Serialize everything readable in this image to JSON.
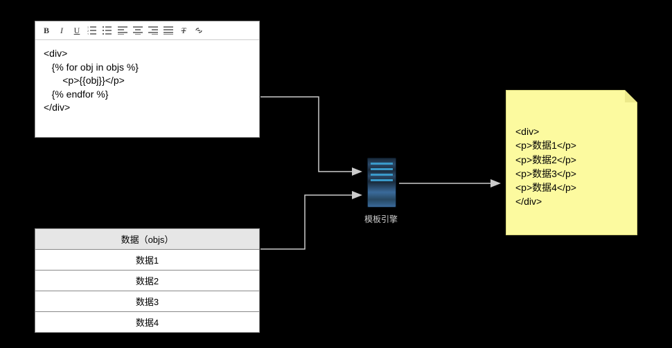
{
  "editor": {
    "toolbar": {
      "bold": "B",
      "italic": "I",
      "underline": "U"
    },
    "code": "<div>\n   {% for obj in objs %}\n       <p>{{obj}}</p>\n   {% endfor %}\n</div>"
  },
  "dataTable": {
    "header": "数据（objs）",
    "rows": [
      "数据1",
      "数据2",
      "数据3",
      "数据4"
    ]
  },
  "server": {
    "label": "模板引擎"
  },
  "output": {
    "code": "<div>\n<p>数据1</p>\n<p>数据2</p>\n<p>数据3</p>\n<p>数据4</p>\n</div>"
  }
}
